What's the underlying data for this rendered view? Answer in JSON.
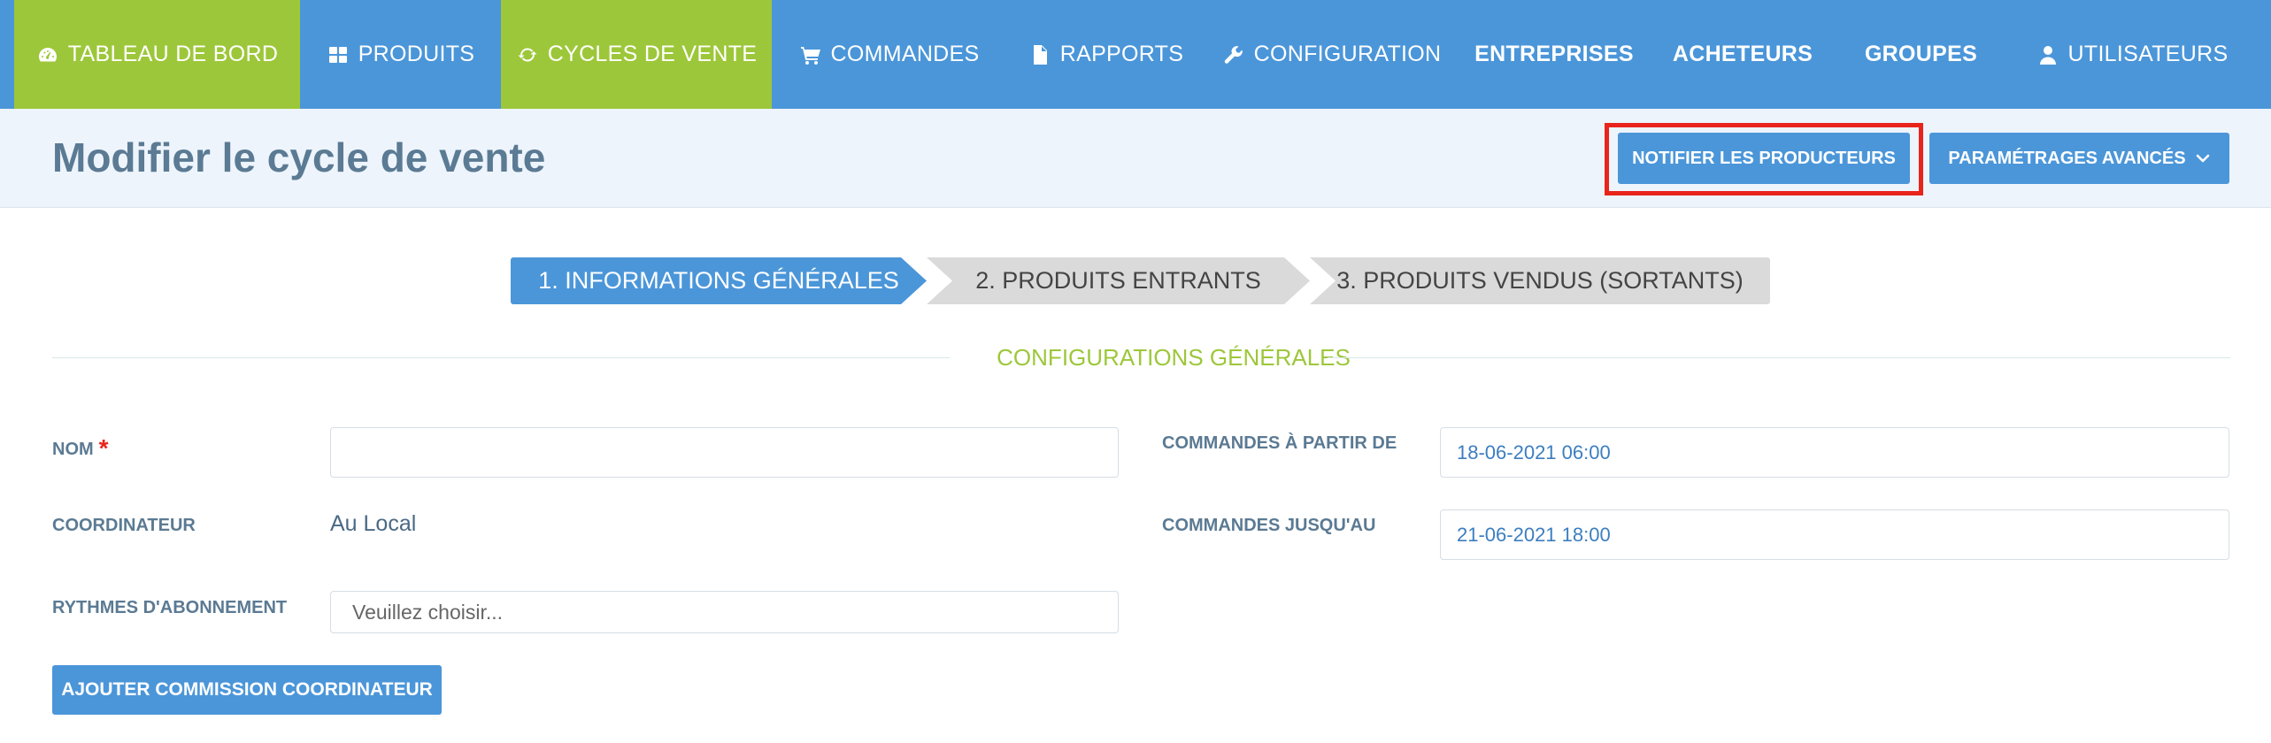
{
  "nav": {
    "items": [
      {
        "label": "TABLEAU DE BORD",
        "icon": "dashboard-icon"
      },
      {
        "label": "PRODUITS",
        "icon": "grid-icon"
      },
      {
        "label": "CYCLES DE VENTE",
        "icon": "refresh-icon"
      },
      {
        "label": "COMMANDES",
        "icon": "cart-icon"
      },
      {
        "label": "RAPPORTS",
        "icon": "file-icon"
      },
      {
        "label": "CONFIGURATION",
        "icon": "wrench-icon"
      },
      {
        "label": "ENTREPRISES"
      },
      {
        "label": "ACHETEURS"
      },
      {
        "label": "GROUPES"
      },
      {
        "label": "UTILISATEURS",
        "icon": "user-icon"
      }
    ],
    "active": [
      "TABLEAU DE BORD",
      "CYCLES DE VENTE"
    ]
  },
  "header": {
    "title": "Modifier le cycle de vente",
    "notify_label": "NOTIFIER LES PRODUCTEURS",
    "advanced_label": "PARAMÉTRAGES AVANCÉS"
  },
  "steps": {
    "items": [
      {
        "label": "1. INFORMATIONS GÉNÉRALES",
        "active": true
      },
      {
        "label": "2. PRODUITS ENTRANTS",
        "active": false
      },
      {
        "label": "3. PRODUITS VENDUS (SORTANTS)",
        "active": false
      }
    ]
  },
  "section": {
    "title": "CONFIGURATIONS GÉNÉRALES"
  },
  "form": {
    "nom": {
      "label": "NOM",
      "required_mark": "*",
      "value": ""
    },
    "coordinateur": {
      "label": "COORDINATEUR",
      "value": "Au Local"
    },
    "rythmes": {
      "label": "RYTHMES D'ABONNEMENT",
      "placeholder": "Veuillez choisir..."
    },
    "commandes_debut": {
      "label": "COMMANDES À PARTIR DE",
      "value": "18-06-2021 06:00"
    },
    "commandes_fin": {
      "label": "COMMANDES JUSQU'AU",
      "value": "21-06-2021 18:00"
    },
    "commission_button": "AJOUTER COMMISSION COORDINATEUR"
  },
  "colors": {
    "primary": "#4b96d9",
    "accent": "#9dc73a",
    "highlight": "#e8241b",
    "header_bg": "#edf4fc"
  }
}
